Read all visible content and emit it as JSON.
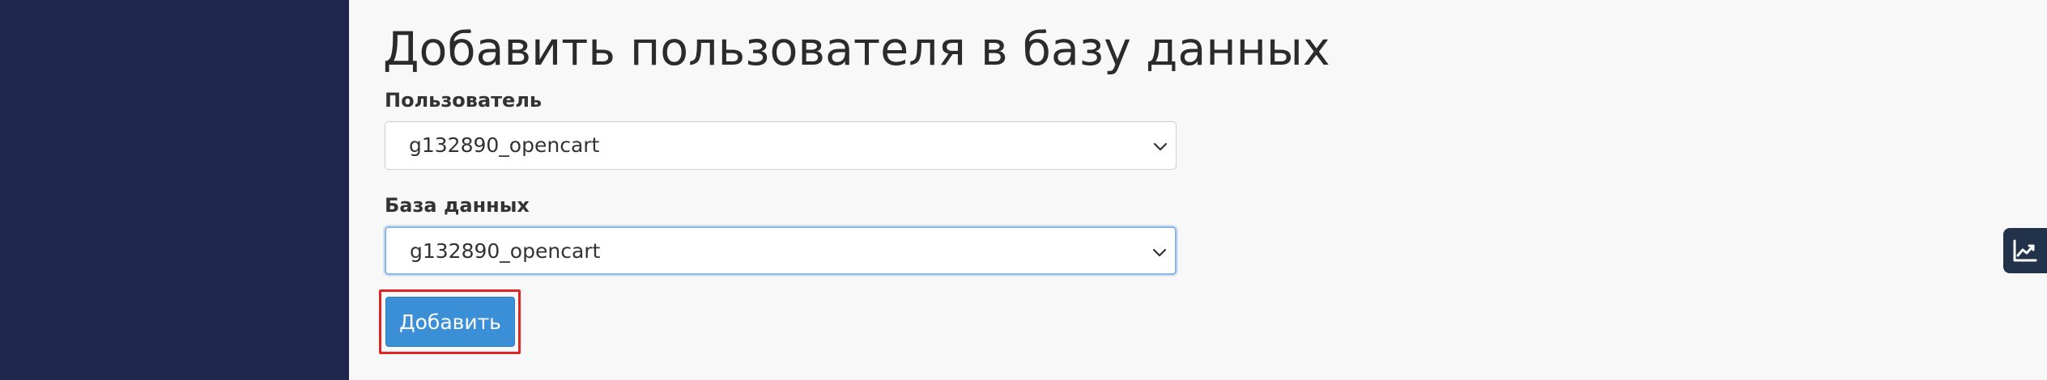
{
  "heading": "Добавить пользователя в базу данных",
  "user_field": {
    "label": "Пользователь",
    "selected": "g132890_opencart"
  },
  "database_field": {
    "label": "База данных",
    "selected": "g132890_opencart"
  },
  "add_button": {
    "label": "Добавить"
  },
  "icons": {
    "select_arrow": "chevron-down-icon",
    "side_tab": "trending-up-chart-icon"
  },
  "colors": {
    "sidebar": "#20274f",
    "background": "#f8f8f8",
    "primary_button": "#3b8fd6",
    "highlight_frame": "#e02424",
    "focus_border": "#86b7e8",
    "side_tab": "#22324a"
  }
}
